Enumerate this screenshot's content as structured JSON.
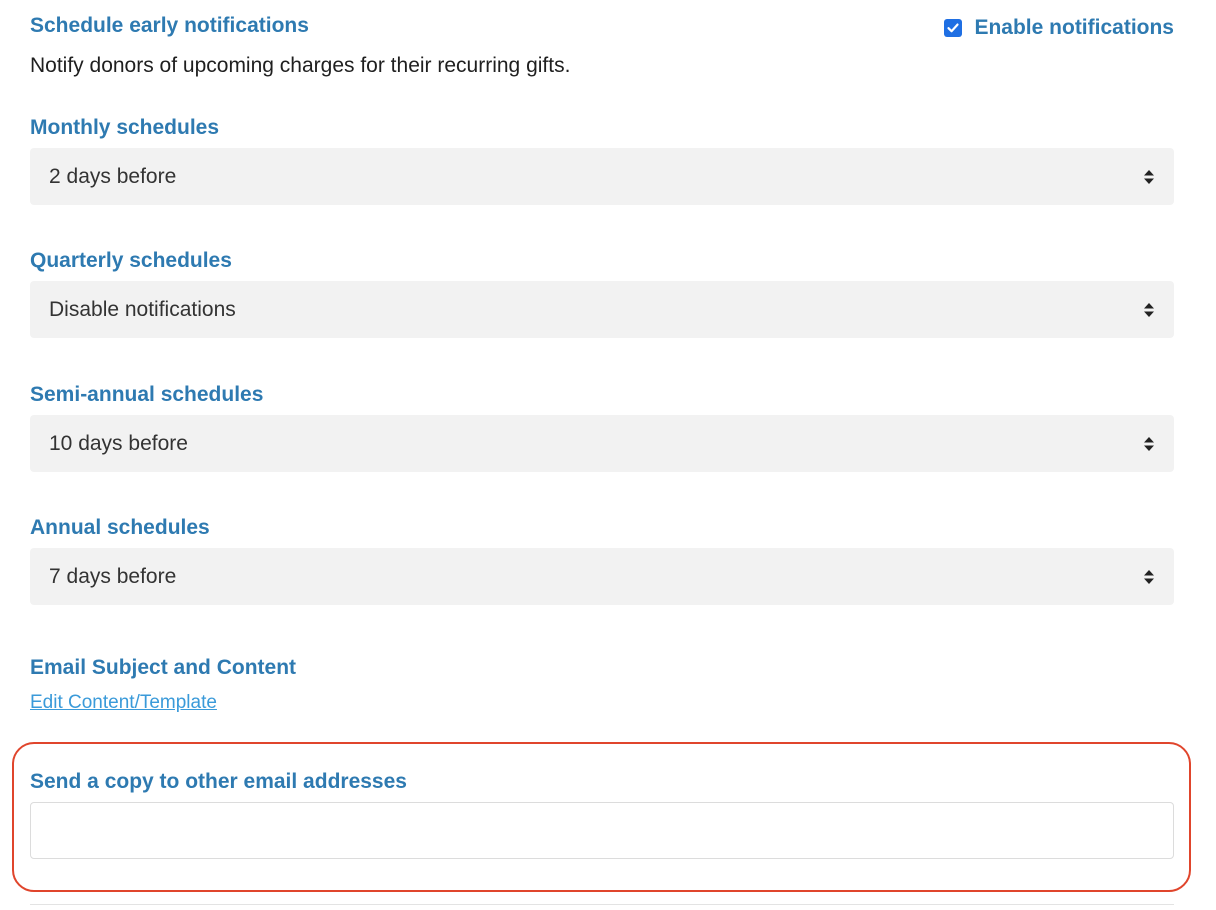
{
  "header": {
    "title": "Schedule early notifications",
    "description": "Notify donors of upcoming charges for their recurring gifts.",
    "enable_label": "Enable notifications",
    "enable_checked": true
  },
  "schedules": [
    {
      "label": "Monthly schedules",
      "selected": "2 days before"
    },
    {
      "label": "Quarterly schedules",
      "selected": "Disable notifications"
    },
    {
      "label": "Semi-annual schedules",
      "selected": "10 days before"
    },
    {
      "label": "Annual schedules",
      "selected": "7 days before"
    }
  ],
  "email_content": {
    "title": "Email Subject and Content",
    "link": "Edit Content/Template"
  },
  "copy_emails": {
    "label": "Send a copy to other email addresses",
    "value": ""
  },
  "colors": {
    "heading": "#2e7ab1",
    "link": "#3a9ad9",
    "highlight": "#e0452c",
    "checkbox": "#1f6fe3"
  }
}
